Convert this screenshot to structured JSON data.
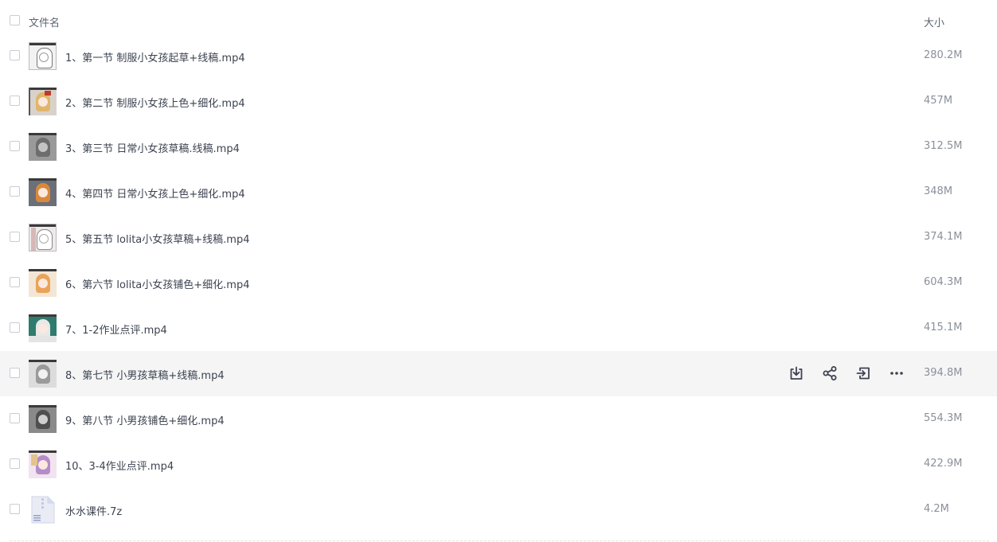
{
  "header": {
    "name_col": "文件名",
    "size_col": "大小"
  },
  "files": [
    {
      "name": "1、第一节 制服小女孩起草+线稿.mp4",
      "size": "280.2M",
      "thumb": "sketch-girl"
    },
    {
      "name": "2、第二节 制服小女孩上色+细化.mp4",
      "size": "457M",
      "thumb": "colored-girl"
    },
    {
      "name": "3、第三节 日常小女孩草稿.线稿.mp4",
      "size": "312.5M",
      "thumb": "gray-girl"
    },
    {
      "name": "4、第四节 日常小女孩上色+细化.mp4",
      "size": "348M",
      "thumb": "orange-hair-girl"
    },
    {
      "name": "5、第五节 lolita小女孩草稿+线稿.mp4",
      "size": "374.1M",
      "thumb": "sketch-lolita"
    },
    {
      "name": "6、第六节 lolita小女孩铺色+细化.mp4",
      "size": "604.3M",
      "thumb": "colored-lolita"
    },
    {
      "name": "7、1-2作业点评.mp4",
      "size": "415.1M",
      "thumb": "review-green"
    },
    {
      "name": "8、第七节 小男孩草稿+线稿.mp4",
      "size": "394.8M",
      "thumb": "sketch-boy"
    },
    {
      "name": "9、第八节 小男孩铺色+细化.mp4",
      "size": "554.3M",
      "thumb": "gray-boy"
    },
    {
      "name": "10、3-4作业点评.mp4",
      "size": "422.9M",
      "thumb": "review-purple"
    },
    {
      "name": "水水课件.7z",
      "size": "4.2M",
      "thumb": "archive-icon"
    }
  ],
  "hover_row_index": 7,
  "row_actions": [
    "download-icon",
    "share-icon",
    "move-icon",
    "more-icon"
  ],
  "colors": {
    "hover_bg": "#f5f5f6",
    "text": "#3c4350",
    "size_text": "#8a909a",
    "icon": "#3d4350"
  }
}
